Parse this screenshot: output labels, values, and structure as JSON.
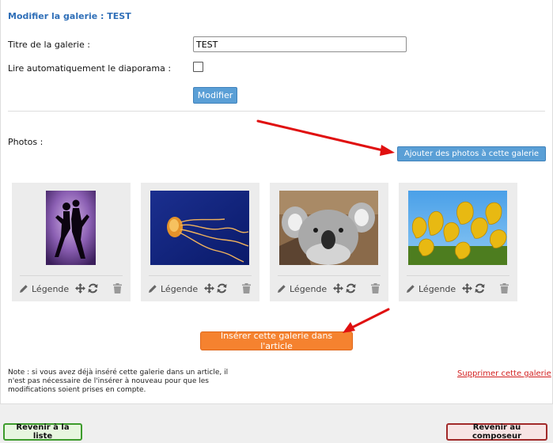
{
  "gallery_form": {
    "heading": "Modifier la galerie : TEST",
    "title_label": "Titre de la galerie :",
    "title_value": "TEST",
    "autoplay_label": "Lire automatiquement le diaporama :",
    "autoplay_checked": false,
    "modify_button": "Modifier"
  },
  "photos": {
    "label": "Photos :",
    "add_button": "Ajouter des photos à cette galerie",
    "items": [
      {
        "subject": "dancers-silhouette",
        "legend_label": "Légende"
      },
      {
        "subject": "jellyfish",
        "legend_label": "Légende"
      },
      {
        "subject": "koala",
        "legend_label": "Légende"
      },
      {
        "subject": "yellow-tulips",
        "legend_label": "Légende"
      }
    ]
  },
  "actions": {
    "insert_button": "Insérer cette galerie dans l'article",
    "note": "Note : si vous avez déjà inséré cette galerie dans un article, il n'est pas nécessaire de l'insérer à nouveau pour que les modifications soient prises en compte.",
    "delete_link": "Supprimer cette galerie",
    "back_to_list_button": "Revenir à la liste",
    "back_to_composer_button": "Revenir au composeur"
  },
  "colors": {
    "heading": "#2f6fb8",
    "primary_button": "#5a9fd6",
    "insert_button": "#f5822f",
    "delete_link": "#d21d1d",
    "annotation_arrow": "#e01010",
    "list_button_border": "#3d9b2c",
    "composer_button_border": "#a12929"
  },
  "icons": {
    "legend": "pencil-icon",
    "move": "move-icon",
    "replace": "refresh-icon",
    "delete": "trash-icon"
  }
}
